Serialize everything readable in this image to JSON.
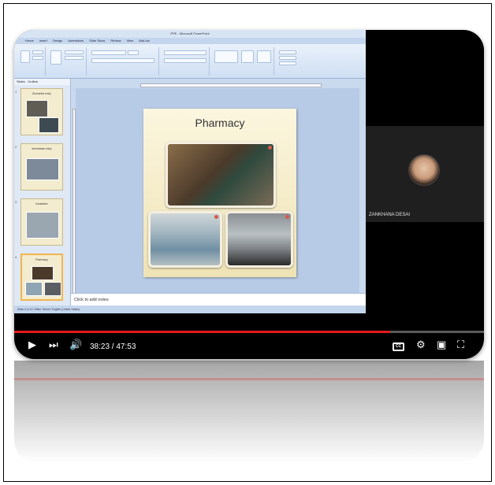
{
  "window": {
    "title": "PPE - Microsoft PowerPoint",
    "tabs": [
      "Home",
      "Insert",
      "Design",
      "Animations",
      "Slide Show",
      "Review",
      "View",
      "Add-Ins"
    ]
  },
  "sidebar": {
    "tabs": [
      "Slides",
      "Outline"
    ],
    "slides": [
      {
        "number": "1",
        "title": "Bronchial entry"
      },
      {
        "number": "2",
        "title": "Immediate entry"
      },
      {
        "number": "3",
        "title": "Inhalation"
      },
      {
        "number": "4",
        "title": "Pharmacy"
      }
    ]
  },
  "slide": {
    "title": "Pharmacy"
  },
  "notes": {
    "placeholder": "Click to add notes"
  },
  "status": {
    "text": "Slide 4 of 10   'Office Theme'   English (United States)"
  },
  "participant": {
    "name": "ZANKHANA DESAI"
  },
  "player": {
    "current_time": "38:23",
    "duration": "47:53",
    "time_display": "38:23 / 47:53",
    "progress": 0.8,
    "accent": "#e21b1b"
  }
}
